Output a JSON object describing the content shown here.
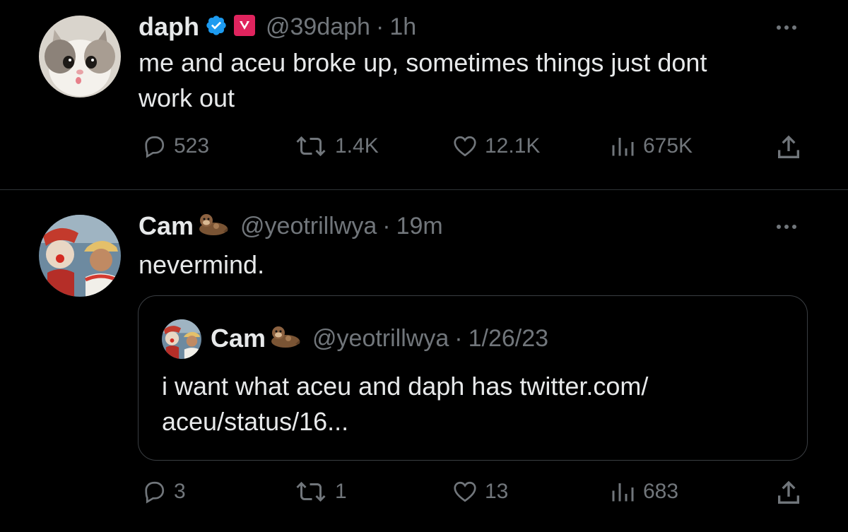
{
  "tweets": [
    {
      "name": "daph",
      "handle": "@39daph",
      "time": "1h",
      "text_lines": [
        "me and aceu broke up, sometimes things just dont",
        "work out"
      ],
      "stats": {
        "replies": "523",
        "retweets": "1.4K",
        "likes": "12.1K",
        "views": "675K"
      }
    },
    {
      "name": "Cam",
      "handle": "@yeotrillwya",
      "time": "19m",
      "text_lines": [
        "nevermind."
      ],
      "stats": {
        "replies": "3",
        "retweets": "1",
        "likes": "13",
        "views": "683"
      },
      "quote": {
        "name": "Cam",
        "handle": "@yeotrillwya",
        "time": "1/26/23",
        "text_lines": [
          "i want what aceu and daph has twitter.com/",
          "aceu/status/16..."
        ]
      }
    }
  ],
  "separator": "·",
  "icons": {
    "reply": "reply-icon",
    "retweet": "retweet-icon",
    "like": "heart-icon",
    "views": "views-icon",
    "share": "share-icon",
    "verified": "verified-badge-icon",
    "affiliate": "affiliate-badge-icon",
    "emoji": "otter-emoji-icon",
    "more": "more-icon"
  },
  "colors": {
    "background": "#000000",
    "text": "#e7e9ea",
    "muted": "#71767b",
    "verified": "#1d9bf0",
    "affiliate": "#e0245e"
  }
}
